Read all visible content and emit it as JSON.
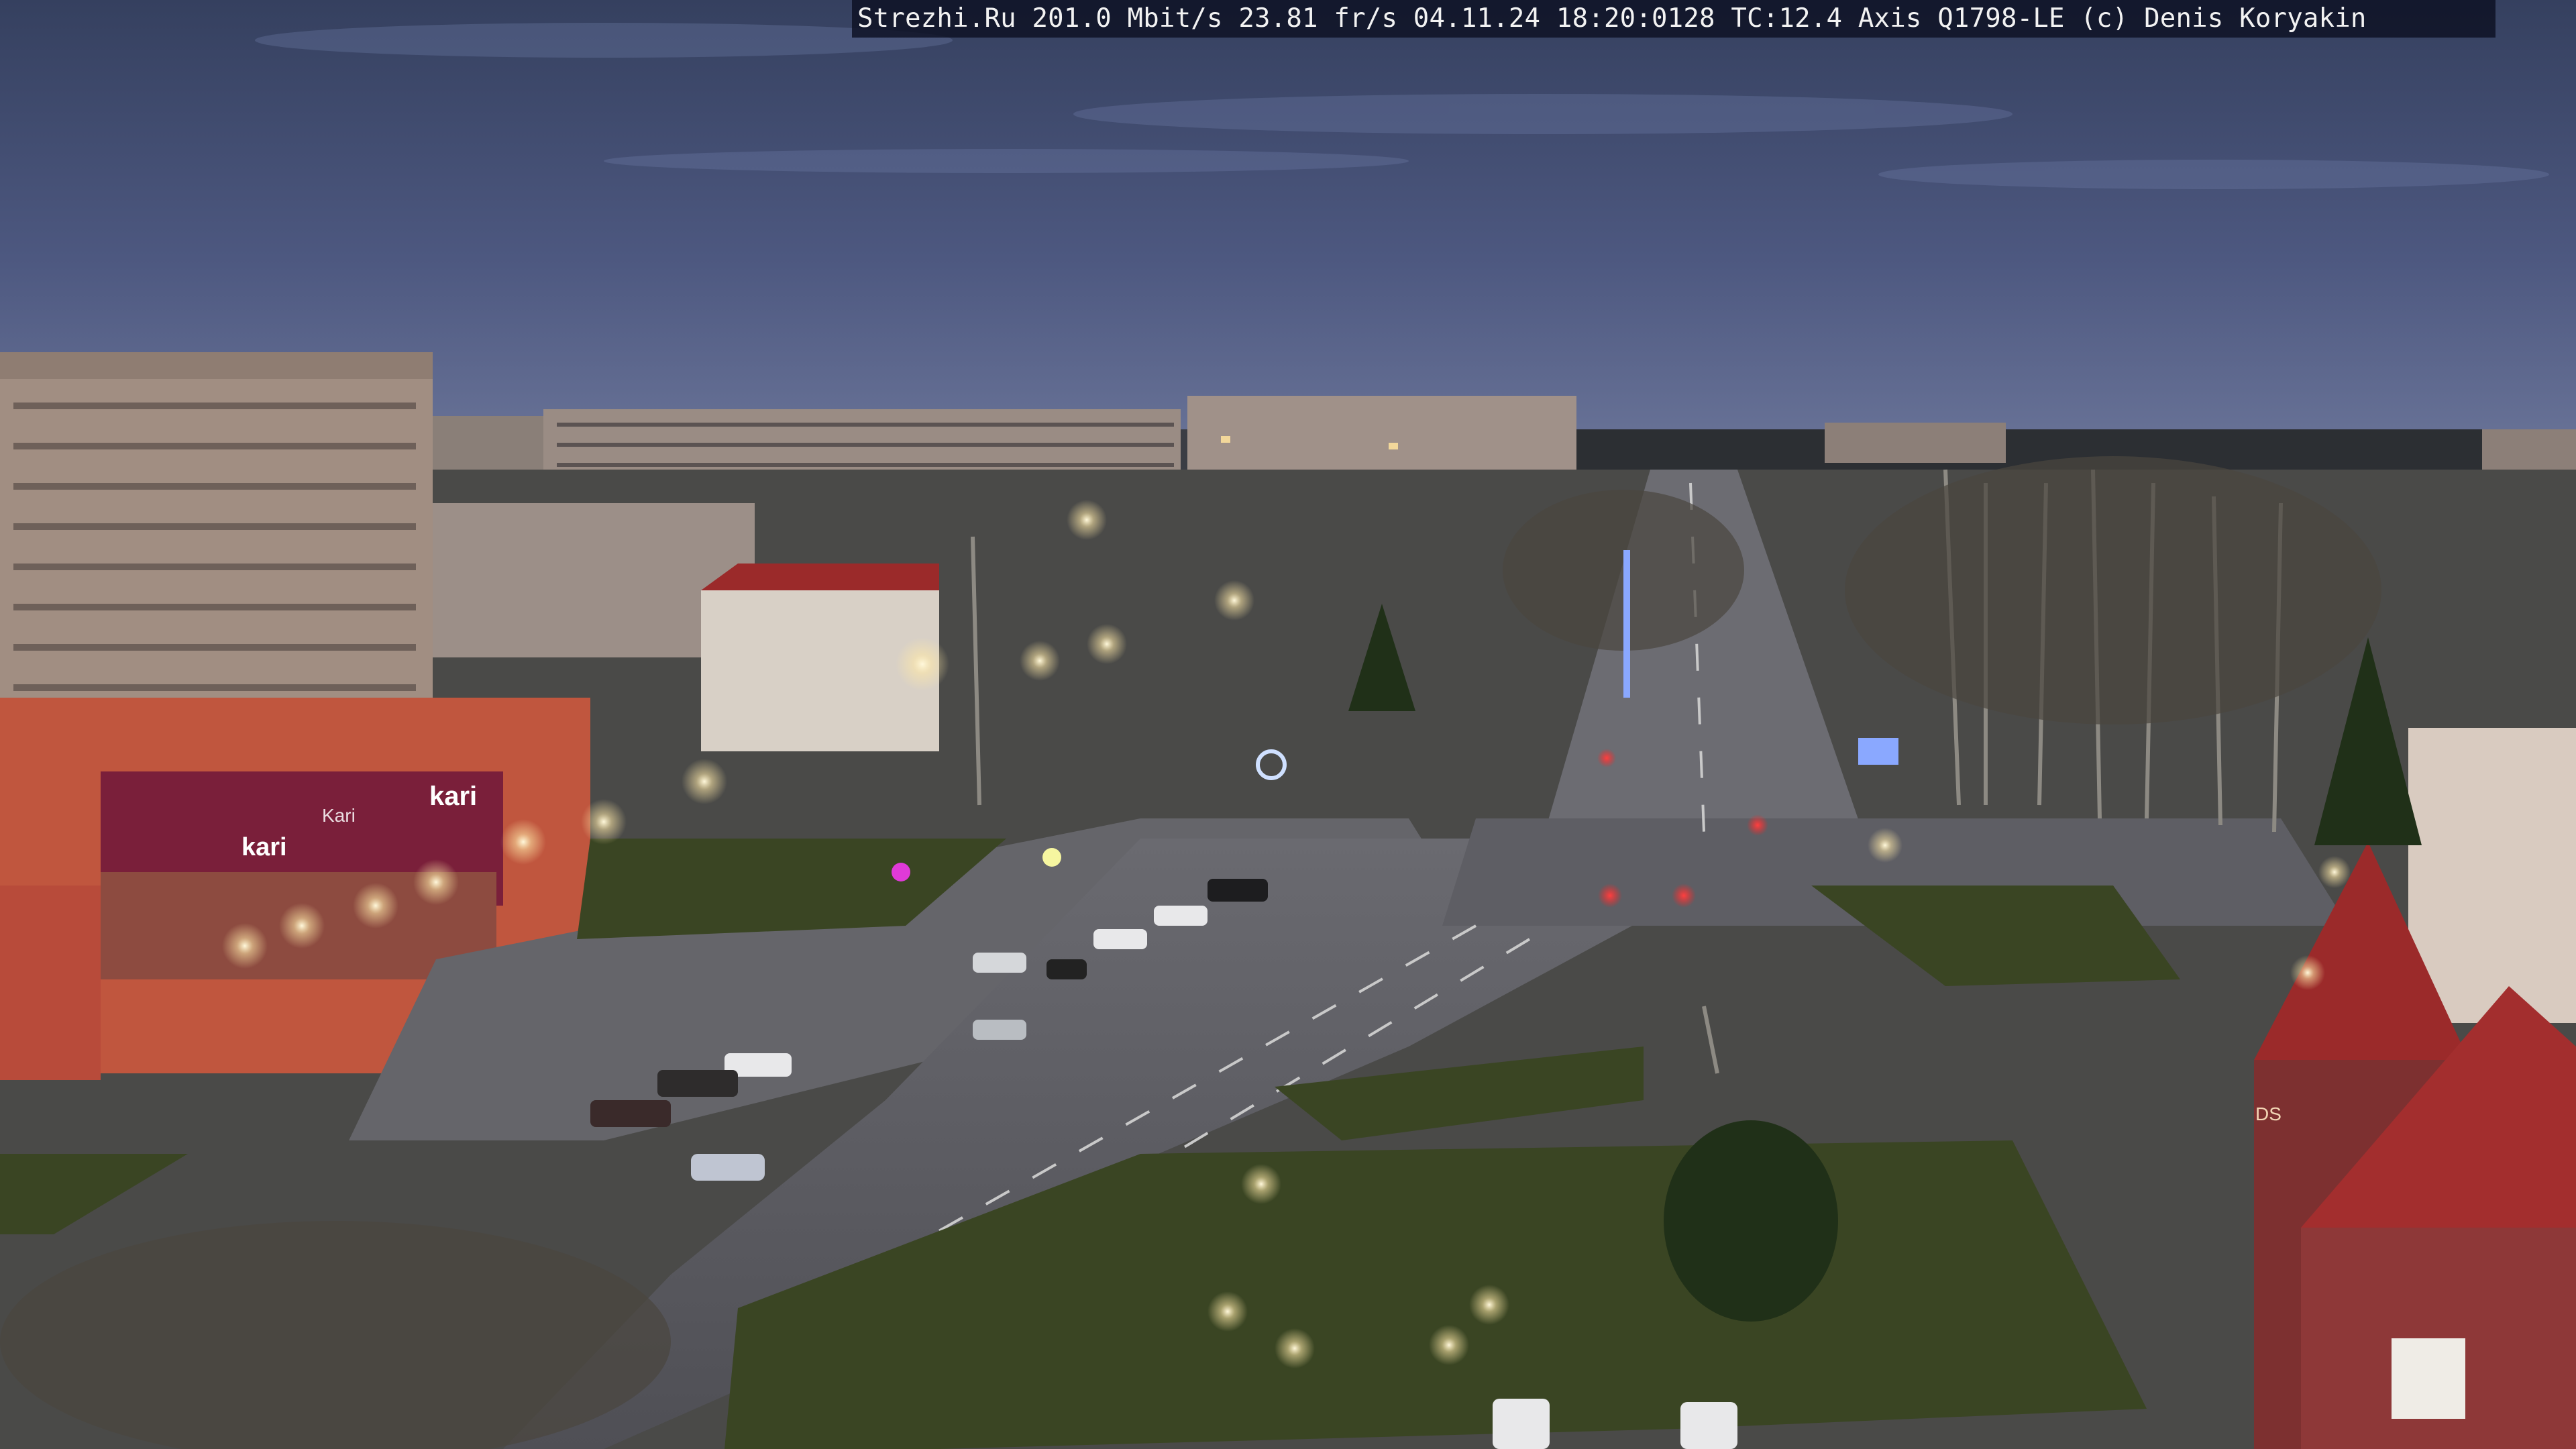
{
  "overlay": {
    "text": "Strezhi.Ru 201.0 Mbit/s 23.81 fr/s 04.11.24 18:20:0128 TC:12.4  Axis Q1798-LE  (c) Denis Koryakin"
  },
  "signs": {
    "store_left": "Kari",
    "store_mid": "kari",
    "store_top": "kari",
    "building_right": "DS"
  },
  "colors": {
    "sky_top": "#39415f",
    "sky_mid": "#4e5a82",
    "sky_horizon": "#6a7496",
    "asphalt": "#5a5a5e",
    "grass": "#37431f",
    "roof_red": "#9b2a2a",
    "street_light": "#fff6d8",
    "red_light": "#ff2a2a"
  }
}
